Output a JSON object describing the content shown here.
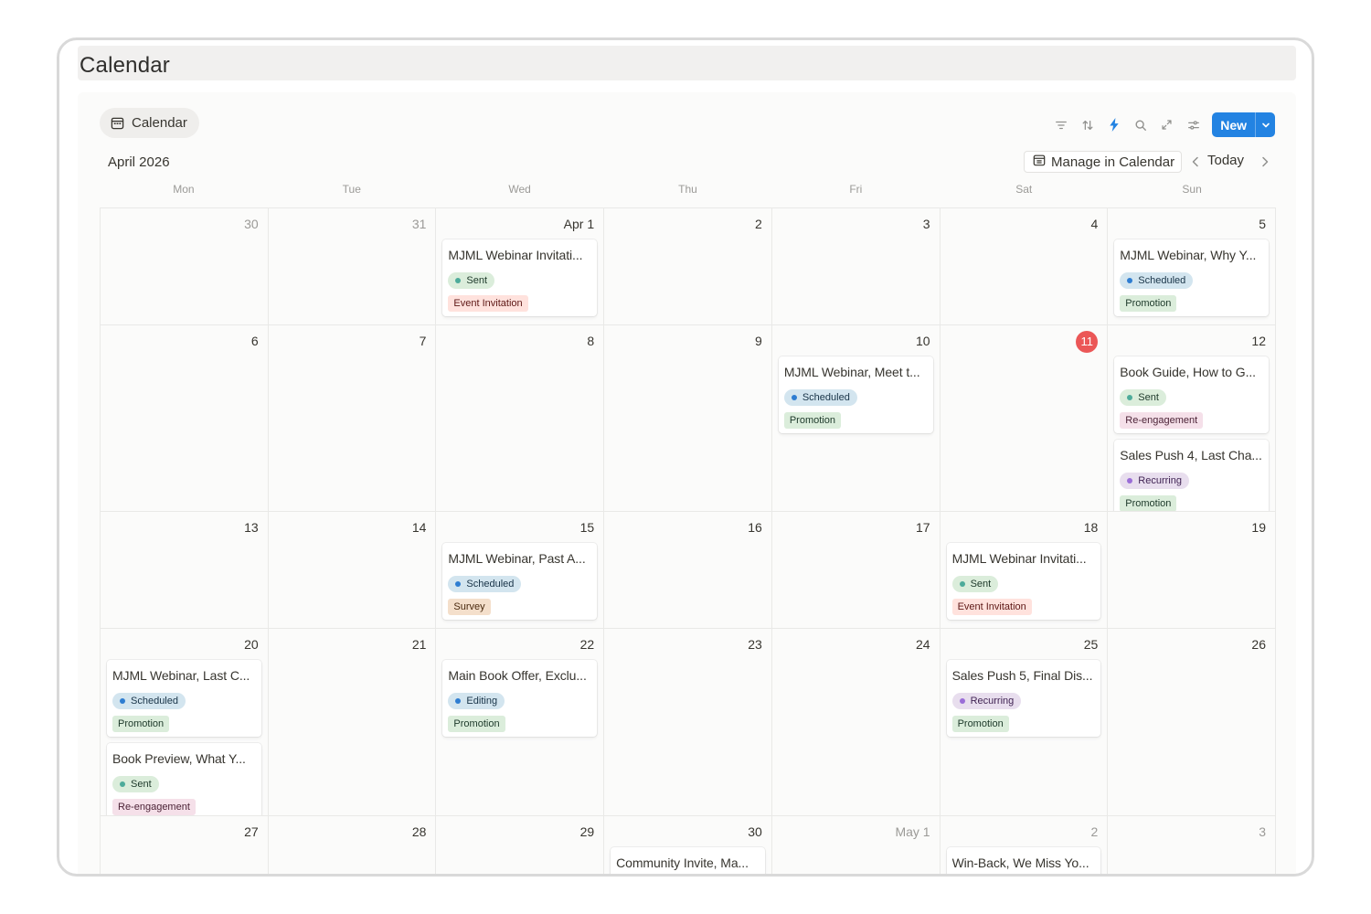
{
  "window": {
    "title": "Calendar"
  },
  "view_tab": {
    "label": "Calendar",
    "icon": "calendar-icon"
  },
  "toolbar": {
    "icons": [
      "filter-icon",
      "sort-icon",
      "lightning-icon",
      "search-icon",
      "expand-icon",
      "settings-sliders-icon"
    ],
    "new_label": "New"
  },
  "header": {
    "month": "April 2026",
    "manage_label": "Manage in Calendar",
    "today_label": "Today"
  },
  "weekdays": [
    "Mon",
    "Tue",
    "Wed",
    "Thu",
    "Fri",
    "Sat",
    "Sun"
  ],
  "colors": {
    "accent": "#2383e2",
    "today_badge": "#eb5757",
    "status": {
      "Sent": {
        "bg": "#dbeddb",
        "fg": "#1c3829",
        "dot": "#4dab9a"
      },
      "Scheduled": {
        "bg": "#d3e5ef",
        "fg": "#183347",
        "dot": "#2e7dd1"
      },
      "Editing": {
        "bg": "#d3e5ef",
        "fg": "#183347",
        "dot": "#2e7dd1"
      },
      "Recurring": {
        "bg": "#e8deee",
        "fg": "#412454",
        "dot": "#9a6dd7"
      }
    },
    "tags": {
      "Event Invitation": {
        "bg": "#ffe2dd",
        "fg": "#5d1715"
      },
      "Promotion": {
        "bg": "#dbeddb",
        "fg": "#1c3829"
      },
      "Re-engagement": {
        "bg": "#f5e0e9",
        "fg": "#4c2337"
      },
      "Survey": {
        "bg": "#f4dfcb",
        "fg": "#49290e"
      }
    }
  },
  "weeks": [
    [
      {
        "day": "30",
        "muted": true,
        "events": []
      },
      {
        "day": "31",
        "muted": true,
        "events": []
      },
      {
        "day": "Apr 1",
        "events": [
          {
            "title": "MJML Webinar Invitati...",
            "status": "Sent",
            "tag": "Event Invitation"
          }
        ]
      },
      {
        "day": "2",
        "events": []
      },
      {
        "day": "3",
        "events": []
      },
      {
        "day": "4",
        "events": []
      },
      {
        "day": "5",
        "events": [
          {
            "title": "MJML Webinar, Why Y...",
            "status": "Scheduled",
            "tag": "Promotion"
          }
        ]
      }
    ],
    [
      {
        "day": "6",
        "events": []
      },
      {
        "day": "7",
        "events": []
      },
      {
        "day": "8",
        "events": []
      },
      {
        "day": "9",
        "events": []
      },
      {
        "day": "10",
        "events": [
          {
            "title": "MJML Webinar, Meet t...",
            "status": "Scheduled",
            "tag": "Promotion"
          }
        ]
      },
      {
        "day": "11",
        "today": true,
        "events": []
      },
      {
        "day": "12",
        "events": [
          {
            "title": "Book Guide, How to G...",
            "status": "Sent",
            "tag": "Re-engagement"
          },
          {
            "title": "Sales Push 4, Last Cha...",
            "status": "Recurring",
            "tag": "Promotion"
          }
        ]
      }
    ],
    [
      {
        "day": "13",
        "events": []
      },
      {
        "day": "14",
        "events": []
      },
      {
        "day": "15",
        "events": [
          {
            "title": "MJML Webinar, Past A...",
            "status": "Scheduled",
            "tag": "Survey"
          }
        ]
      },
      {
        "day": "16",
        "events": []
      },
      {
        "day": "17",
        "events": []
      },
      {
        "day": "18",
        "events": [
          {
            "title": "MJML Webinar Invitati...",
            "status": "Sent",
            "tag": "Event Invitation"
          }
        ]
      },
      {
        "day": "19",
        "events": []
      }
    ],
    [
      {
        "day": "20",
        "events": [
          {
            "title": "MJML Webinar, Last C...",
            "status": "Scheduled",
            "tag": "Promotion"
          },
          {
            "title": "Book Preview, What Y...",
            "status": "Sent",
            "tag": "Re-engagement"
          }
        ]
      },
      {
        "day": "21",
        "events": []
      },
      {
        "day": "22",
        "events": [
          {
            "title": "Main Book Offer, Exclu...",
            "status": "Editing",
            "tag": "Promotion"
          }
        ]
      },
      {
        "day": "23",
        "events": []
      },
      {
        "day": "24",
        "events": []
      },
      {
        "day": "25",
        "events": [
          {
            "title": "Sales Push 5, Final Dis...",
            "status": "Recurring",
            "tag": "Promotion"
          }
        ]
      },
      {
        "day": "26",
        "events": []
      }
    ],
    [
      {
        "day": "27",
        "events": []
      },
      {
        "day": "28",
        "events": []
      },
      {
        "day": "29",
        "events": []
      },
      {
        "day": "30",
        "events": [
          {
            "title": "Community Invite, Ma...",
            "status": "",
            "tag": ""
          }
        ]
      },
      {
        "day": "May 1",
        "muted": true,
        "events": []
      },
      {
        "day": "2",
        "muted": true,
        "events": [
          {
            "title": "Win-Back, We Miss Yo...",
            "status": "",
            "tag": ""
          }
        ]
      },
      {
        "day": "3",
        "muted": true,
        "events": []
      }
    ]
  ]
}
